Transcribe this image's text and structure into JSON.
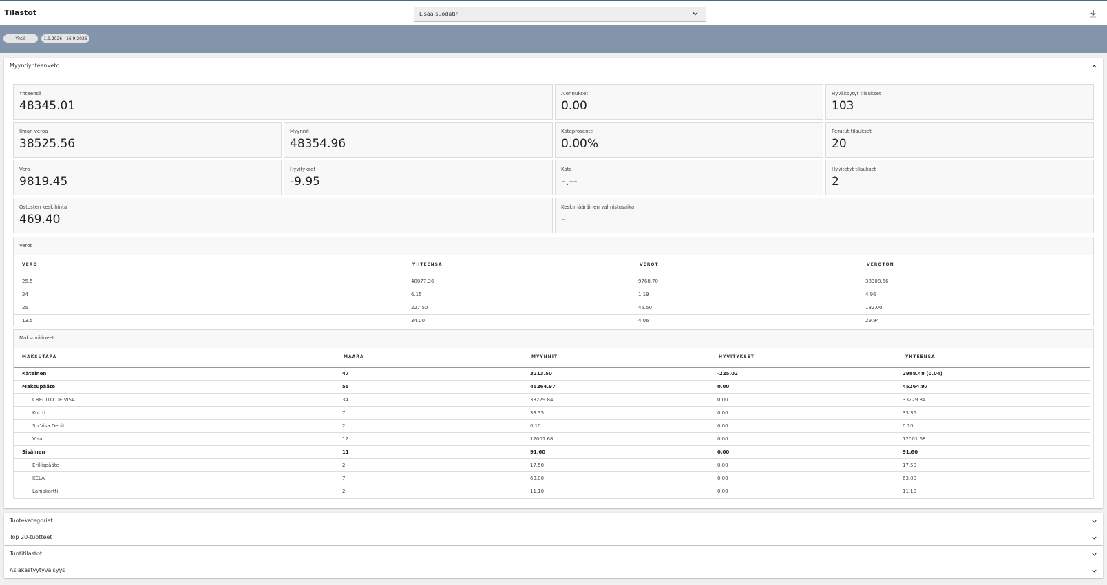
{
  "app": {
    "title": "Tilastot"
  },
  "filter": {
    "placeholder": "Lisää suodatin",
    "chevron_icon": "chevron-down-icon"
  },
  "download_icon": "download-icon",
  "chips": [
    "Yhtiö",
    "1.9.2026 - 16.9.2026"
  ],
  "summary": {
    "title": "Myyntiyhteenveto",
    "cards": {
      "yhteensa": {
        "label": "Yhteensä",
        "value": "48345.01"
      },
      "alennukset": {
        "label": "Alennukset",
        "value": "0.00"
      },
      "hyvaksytyt": {
        "label": "Hyväksytyt tilaukset",
        "value": "103"
      },
      "ilman_veroa": {
        "label": "Ilman veroa",
        "value": "38525.56"
      },
      "myynnit": {
        "label": "Myynnit",
        "value": "48354.96"
      },
      "kateprosentti": {
        "label": "Kateprosentti",
        "value": "0.00%"
      },
      "perutut": {
        "label": "Perutut tilaukset",
        "value": "20"
      },
      "vero": {
        "label": "Vero",
        "value": "9819.45"
      },
      "hyvitykset": {
        "label": "Hyvitykset",
        "value": "-9.95"
      },
      "kate": {
        "label": "Kate",
        "value": "-.--"
      },
      "hyvitetyt": {
        "label": "Hyvitetyt tilaukset",
        "value": "2"
      },
      "ostosten": {
        "label": "Ostosten keskihinta",
        "value": "469.40"
      },
      "valmistusaika": {
        "label": "Keskimääräinen valmistusaika",
        "value": "-"
      }
    },
    "taxes": {
      "title": "Verot",
      "headers": [
        "VERO",
        "YHTEENSÄ",
        "VEROT",
        "VEROTON"
      ],
      "rows": [
        [
          "25.5",
          "48077.36",
          "9768.70",
          "38308.66"
        ],
        [
          "24",
          "6.15",
          "1.19",
          "4.96"
        ],
        [
          "25",
          "227.50",
          "45.50",
          "182.00"
        ],
        [
          "13.5",
          "34.00",
          "4.06",
          "29.94"
        ]
      ]
    },
    "payments": {
      "title": "Maksuvälineet",
      "headers": [
        "MAKSUTAPA",
        "MÄÄRÄ",
        "MYYNNIT",
        "HYVITYKSET",
        "YHTEENSÄ"
      ],
      "rows": [
        [
          "Käteinen",
          "47",
          "3213.50",
          "-225.02",
          "2988.48 (0.04)"
        ],
        [
          "Maksupääte",
          "55",
          "45264.97",
          "0.00",
          "45264.97"
        ],
        [
          "CREDITO DE VISA",
          "34",
          "33229.84",
          "0.00",
          "33229.84"
        ],
        [
          "Kortti",
          "7",
          "33.35",
          "0.00",
          "33.35"
        ],
        [
          "Sp Visa Debit",
          "2",
          "0.10",
          "0.00",
          "0.10"
        ],
        [
          "Visa",
          "12",
          "12001.68",
          "0.00",
          "12001.68"
        ],
        [
          "Sisäinen",
          "11",
          "91.60",
          "0.00",
          "91.60"
        ],
        [
          "Erillispääte",
          "2",
          "17.50",
          "0.00",
          "17.50"
        ],
        [
          "KELA",
          "7",
          "63.00",
          "0.00",
          "63.00"
        ],
        [
          "Lahjakortti",
          "2",
          "11.10",
          "0.00",
          "11.10"
        ]
      ]
    }
  },
  "sections": [
    "Tuotekategoriat",
    "Top 20-tuotteet",
    "Tuntitilastot",
    "Asiakastyytyväisyys"
  ],
  "colors": {
    "band": "#8395ab",
    "accent": "#3b6d8c"
  }
}
